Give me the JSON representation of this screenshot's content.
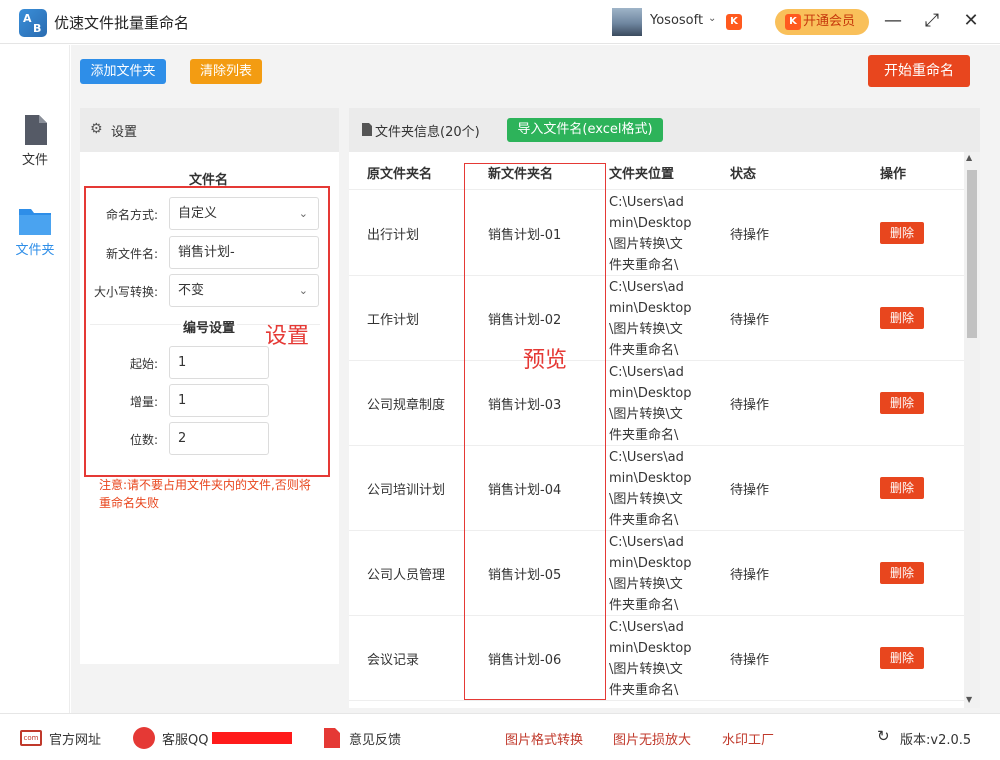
{
  "app": {
    "title": "优速文件批量重命名",
    "username": "Yososoft",
    "vip_label": "开通会员"
  },
  "window_controls": {
    "minimize": "—",
    "maximize": "⤢",
    "close": "✕"
  },
  "sidebar": {
    "items": [
      {
        "label": "文件",
        "icon": "file-icon"
      },
      {
        "label": "文件夹",
        "icon": "folder-icon",
        "active": true
      }
    ]
  },
  "toolbar": {
    "add_folder": "添加文件夹",
    "clear_list": "清除列表",
    "start_rename": "开始重命名"
  },
  "settings": {
    "header": "设置",
    "section_filename": "文件名",
    "naming_mode_label": "命名方式:",
    "naming_mode_value": "自定义",
    "new_filename_label": "新文件名:",
    "new_filename_value": "销售计划-",
    "case_label": "大小写转换:",
    "case_value": "不变",
    "section_numbering": "编号设置",
    "start_label": "起始:",
    "start_value": "1",
    "increment_label": "增量:",
    "increment_value": "1",
    "digits_label": "位数:",
    "digits_value": "2",
    "notice": "注意:请不要占用文件夹内的文件,否则将重命名失败"
  },
  "filepanel": {
    "header": "文件夹信息(20个)",
    "import_button": "导入文件名(excel格式)",
    "columns": [
      "原文件夹名",
      "新文件夹名",
      "文件夹位置",
      "状态",
      "操作"
    ],
    "rows": [
      {
        "original": "出行计划",
        "new": "销售计划-01",
        "location": "C:\\Users\\admin\\Desktop\\图片转换\\文件夹重命名\\",
        "status": "待操作",
        "action": "删除"
      },
      {
        "original": "工作计划",
        "new": "销售计划-02",
        "location": "C:\\Users\\admin\\Desktop\\图片转换\\文件夹重命名\\",
        "status": "待操作",
        "action": "删除"
      },
      {
        "original": "公司规章制度",
        "new": "销售计划-03",
        "location": "C:\\Users\\admin\\Desktop\\图片转换\\文件夹重命名\\",
        "status": "待操作",
        "action": "删除"
      },
      {
        "original": "公司培训计划",
        "new": "销售计划-04",
        "location": "C:\\Users\\admin\\Desktop\\图片转换\\文件夹重命名\\",
        "status": "待操作",
        "action": "删除"
      },
      {
        "original": "公司人员管理",
        "new": "销售计划-05",
        "location": "C:\\Users\\admin\\Desktop\\图片转换\\文件夹重命名\\",
        "status": "待操作",
        "action": "删除"
      },
      {
        "original": "会议记录",
        "new": "销售计划-06",
        "location": "C:\\Users\\admin\\Desktop\\图片转换\\文件夹重命名\\",
        "status": "待操作",
        "action": "删除"
      }
    ]
  },
  "annotations": {
    "settings": "设置",
    "preview": "预览"
  },
  "footer": {
    "website": "官方网址",
    "support": "客服QQ",
    "feedback": "意见反馈",
    "image_convert": "图片格式转换",
    "image_enlarge": "图片无损放大",
    "watermark": "水印工厂",
    "version": "版本:v2.0.5"
  },
  "colors": {
    "accent_blue": "#2e8ee8",
    "accent_orange": "#f39c12",
    "danger": "#e8461e",
    "green": "#2db35a"
  }
}
